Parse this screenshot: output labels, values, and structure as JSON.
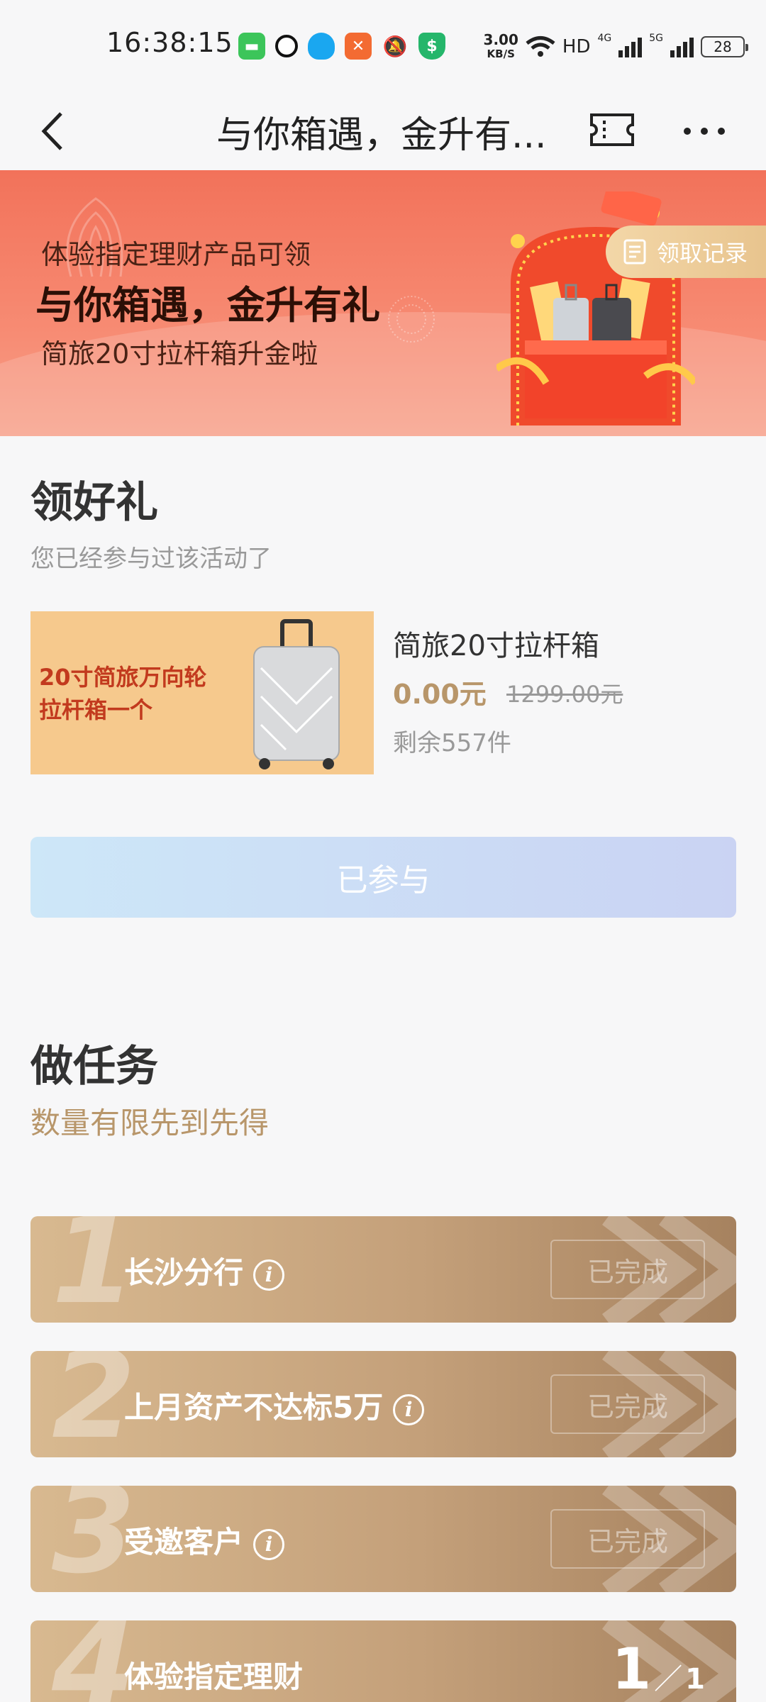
{
  "status_bar": {
    "time": "16:38:15",
    "net_speed_value": "3.00",
    "net_speed_unit": "KB/S",
    "hd": "HD",
    "net_4g": "4G",
    "net_5g": "5G",
    "battery": "28"
  },
  "nav": {
    "title": "与你箱遇，金升有..."
  },
  "banner": {
    "subtitle": "体验指定理财产品可领",
    "title": "与你箱遇，金升有礼",
    "desc": "简旅20寸拉杆箱升金啦",
    "record_label": "领取记录"
  },
  "gift_section": {
    "title": "领好礼",
    "subtitle": "您已经参与过该活动了",
    "prize": {
      "image_text": "20寸简旅万向轮拉杆箱一个",
      "name": "简旅20寸拉杆箱",
      "price": "0.00元",
      "original_price": "1299.00元",
      "stock": "剩余557件"
    },
    "joined_label": "已参与"
  },
  "task_section": {
    "title": "做任务",
    "subtitle": "数量有限先到先得",
    "tasks": [
      {
        "num": "1",
        "label": "长沙分行",
        "status": "已完成"
      },
      {
        "num": "2",
        "label": "上月资产不达标5万",
        "status": "已完成"
      },
      {
        "num": "3",
        "label": "受邀客户",
        "status": "已完成"
      },
      {
        "num": "4",
        "label": "体验指定理财",
        "progress_current": "1",
        "progress_total": "1"
      }
    ]
  },
  "colors": {
    "banner": "#f2725a",
    "gold": "#b8966a",
    "task_bg": "#c4a07a",
    "joined_btn": "#cde7f8"
  }
}
